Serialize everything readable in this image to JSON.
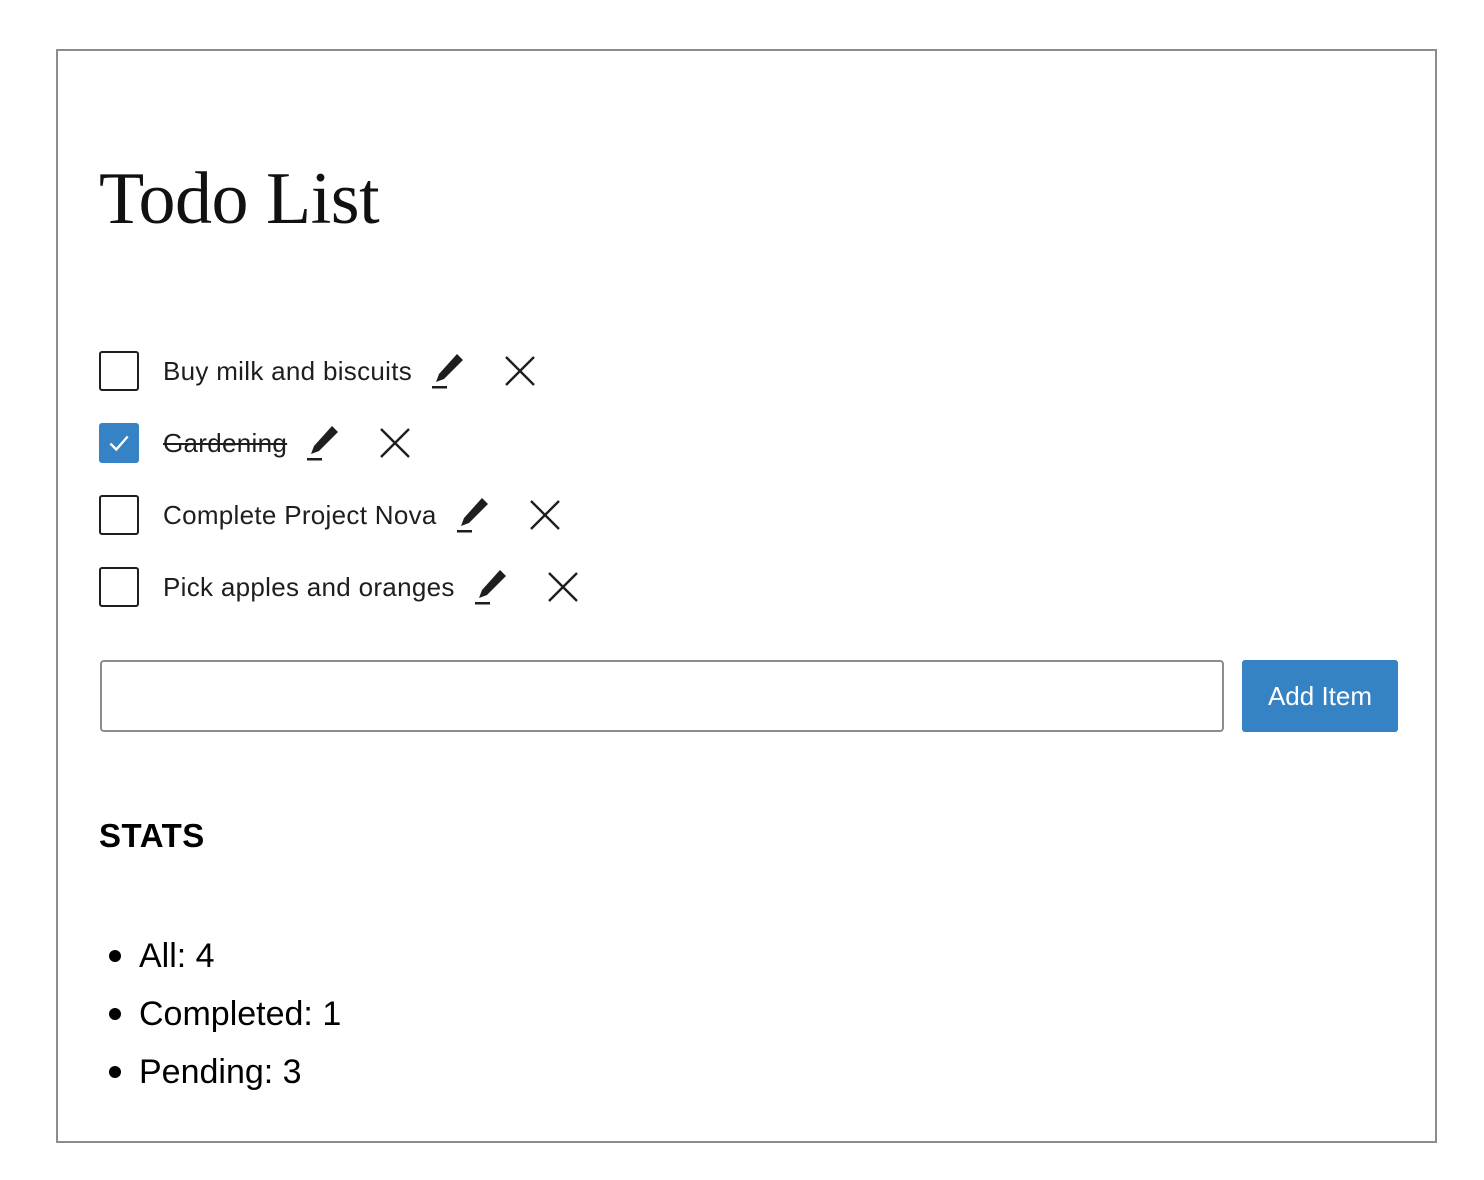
{
  "title": "Todo List",
  "todos": [
    {
      "label": "Buy milk and biscuits",
      "completed": false
    },
    {
      "label": "Gardening",
      "completed": true
    },
    {
      "label": "Complete Project Nova",
      "completed": false
    },
    {
      "label": "Pick apples and oranges",
      "completed": false
    }
  ],
  "input": {
    "value": "",
    "placeholder": ""
  },
  "add_button_label": "Add Item",
  "stats": {
    "heading": "STATS",
    "items": [
      "All: 4",
      "Completed: 1",
      "Pending: 3"
    ]
  },
  "icons": {
    "edit": "pencil-icon",
    "delete": "close-icon",
    "check": "checkmark-icon"
  },
  "colors": {
    "accent": "#3582c4",
    "border": "#8c8c8c",
    "text": "#1e1e1e"
  }
}
